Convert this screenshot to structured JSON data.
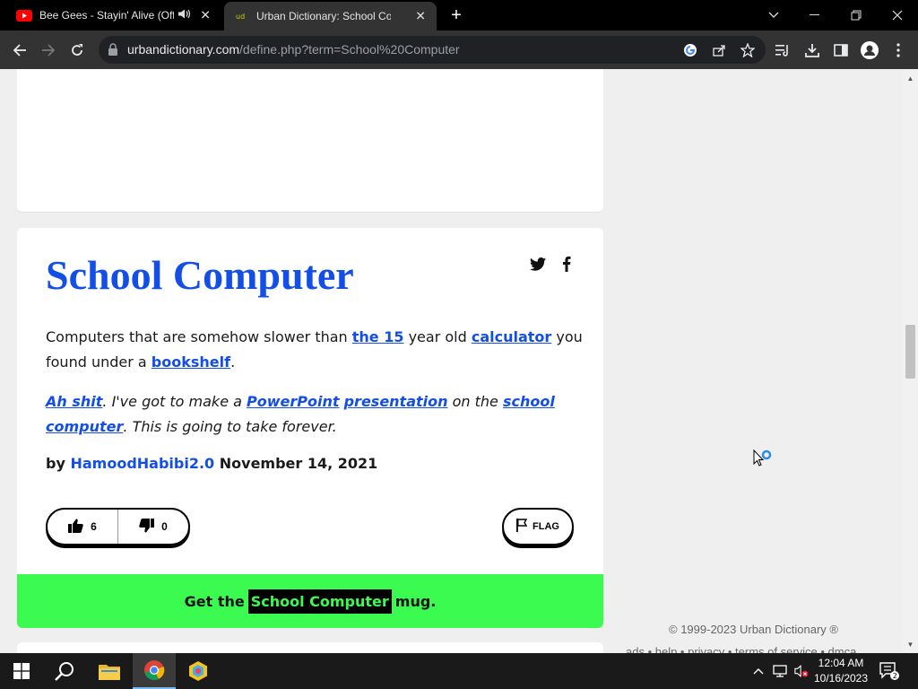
{
  "browser": {
    "tabs": [
      {
        "title": "Bee Gees - Stayin' Alive (Offi",
        "favicon": "youtube-icon",
        "audio": true
      },
      {
        "title": "Urban Dictionary: School Compu",
        "favicon": "urban-dictionary-icon",
        "active": true
      }
    ],
    "url_host": "urbandictionary.com",
    "url_path": "/define.php?term=School%20Computer"
  },
  "entry": {
    "word": "School Computer",
    "meaning_parts": {
      "t1": "Computers that are somehow slower than ",
      "l1": "the 15",
      "t2": " year old ",
      "l2": "calculator",
      "t3": " you found under a ",
      "l3": "bookshelf",
      "t4": "."
    },
    "example_parts": {
      "l1": "Ah shit",
      "t1": ". I've got to make a ",
      "l2": "PowerPoint",
      "t2": " ",
      "l3": "presentation",
      "t3": " on the ",
      "l4": "school computer",
      "t4": ". This is going to take forever."
    },
    "by_label": "by",
    "author": "HamoodHabibi2.0",
    "date": "November 14, 2021",
    "upvotes": "6",
    "downvotes": "0",
    "flag_label": "FLAG"
  },
  "mug": {
    "prefix": "Get the",
    "highlight": "School Computer",
    "suffix": "mug."
  },
  "footer": {
    "copyright": "© 1999-2023 Urban Dictionary ®",
    "links": "ads  •  help  •  privacy  •  terms of service  •  dmca"
  },
  "taskbar": {
    "time": "12:04 AM",
    "date": "10/16/2023",
    "notification_count": "2"
  },
  "colors": {
    "link_blue": "#134fe6",
    "mug_green": "#3bfa50"
  }
}
